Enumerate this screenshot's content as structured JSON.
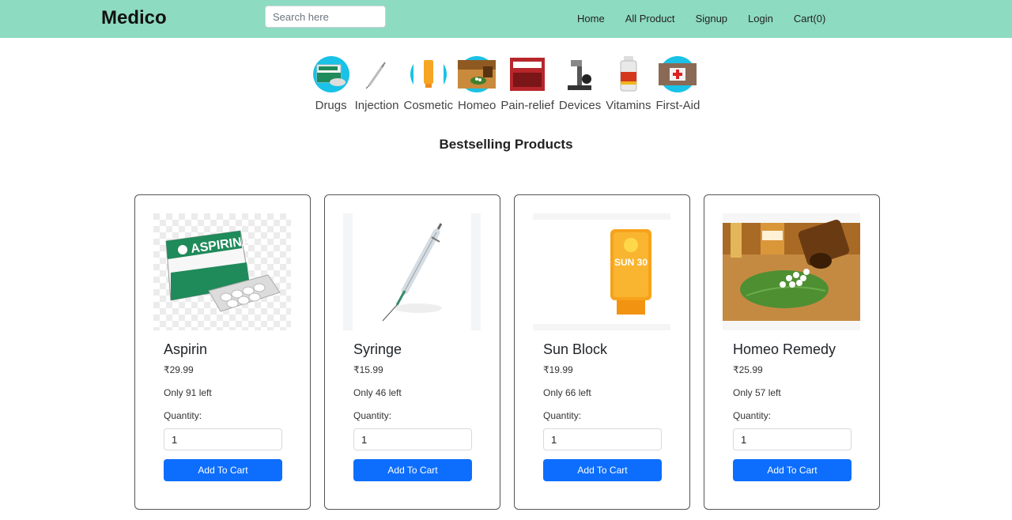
{
  "navbar": {
    "brand": "Medico",
    "search_placeholder": "Search here",
    "links": [
      "Home",
      "All Product",
      "Signup",
      "Login",
      "Cart(0)"
    ]
  },
  "categories": [
    "Drugs",
    "Injection",
    "Cosmetic",
    "Homeo",
    "Pain-relief",
    "Devices",
    "Vitamins",
    "First-Aid"
  ],
  "section_title": "Bestselling Products",
  "products": [
    {
      "name": "Aspirin",
      "price": "₹29.99",
      "stock": "Only 91 left",
      "qty_label": "Quantity:",
      "qty": "1",
      "button": "Add To Cart",
      "image_text": "ASPIRINA"
    },
    {
      "name": "Syringe",
      "price": "₹15.99",
      "stock": "Only 46 left",
      "qty_label": "Quantity:",
      "qty": "1",
      "button": "Add To Cart"
    },
    {
      "name": "Sun Block",
      "price": "₹19.99",
      "stock": "Only 66 left",
      "qty_label": "Quantity:",
      "qty": "1",
      "button": "Add To Cart",
      "image_text": "SUN 30"
    },
    {
      "name": "Homeo Remedy",
      "price": "₹25.99",
      "stock": "Only 57 left",
      "qty_label": "Quantity:",
      "qty": "1",
      "button": "Add To Cart"
    }
  ],
  "colors": {
    "navbar": "#8ddbc0",
    "button": "#0d6efd",
    "category_circle": "#19c2e6"
  }
}
